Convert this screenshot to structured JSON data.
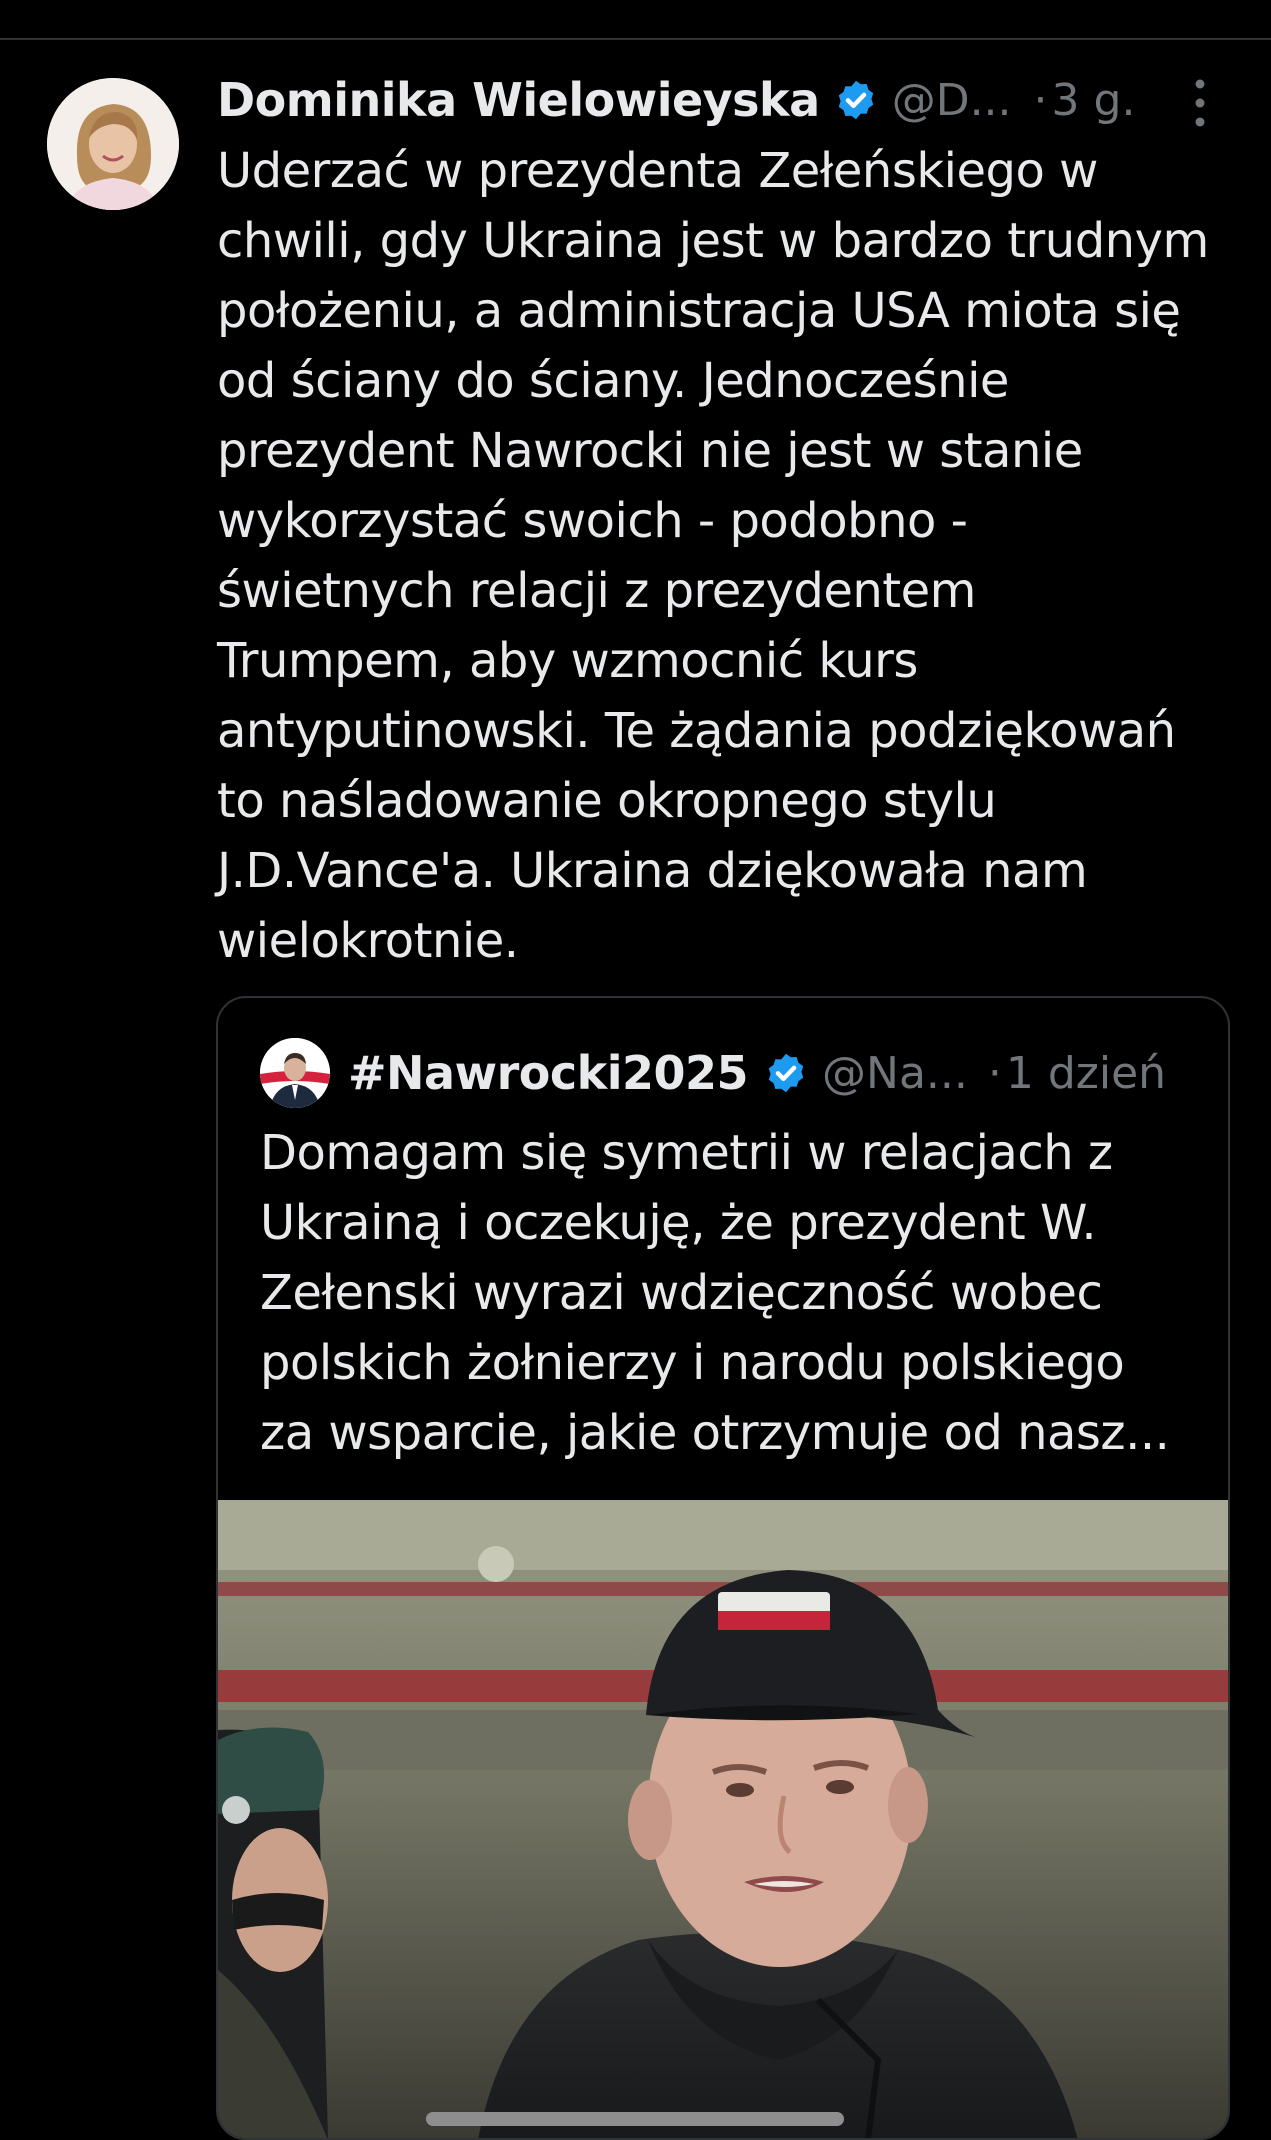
{
  "tweet": {
    "author_name": "Dominika Wielowieyska",
    "handle": "@D...",
    "separator": "·",
    "time": "3 g.",
    "text": "Uderzać w prezydenta Zełeńskiego w\nchwili, gdy Ukraina jest w bardzo trudnym\npołożeniu, a administracja USA miota się\nod ściany do ściany. Jednocześnie\nprezydent Nawrocki nie jest w stanie\nwykorzystać swoich - podobno -\nświetnych relacji z prezydentem\nTrumpem, aby wzmocnić kurs\nantyputinowski. Te żądania podziękowań\nto naśladowanie okropnego stylu\nJ.D.Vance'a. Ukraina dziękowała nam\nwielokrotnie."
  },
  "quote": {
    "author_name": "#Nawrocki2025",
    "handle": "@Na...",
    "separator": "·",
    "time": "1 dzień",
    "text": "Domagam się symetrii w relacjach z\nUkrainą i oczekuję, że prezydent W.\nZełenski wyrazi wdzięczność wobec\npolskich żołnierzy i narodu polskiego\nza wsparcie, jakie otrzymuje od nasz..."
  },
  "icons": {
    "verified": "verified-badge-icon",
    "more": "more-vertical-icon"
  },
  "colors": {
    "background": "#000000",
    "text_primary": "#e7e9ea",
    "text_secondary": "#71767b",
    "verified_blue": "#1d9bf0",
    "border": "#2f3336"
  }
}
